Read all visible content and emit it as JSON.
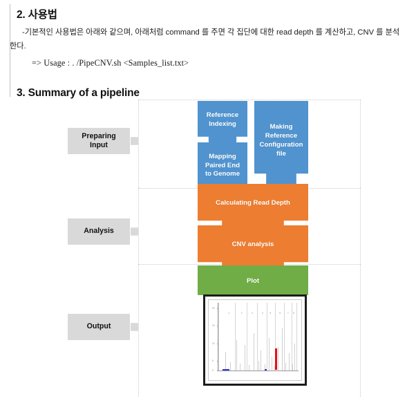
{
  "document": {
    "section2": {
      "heading": "2. 사용법",
      "paragraph": "-기본적인 사용법은 아래와 같으며, 아래처럼 command 를 주면 각 집단에 대한 read depth 를 계산하고, CNV 를 분석한다.",
      "usage": "=> Usage : . /PipeCNV.sh <Samples_list.txt>"
    },
    "section3": {
      "heading": "3. Summary of a pipeline"
    }
  },
  "pipeline": {
    "stages": [
      {
        "label_line1": "Preparing",
        "label_line2": "Input"
      },
      {
        "label_line1": "Analysis",
        "label_line2": ""
      },
      {
        "label_line1": "Output",
        "label_line2": ""
      }
    ],
    "blocks": {
      "reference_indexing": "Reference\nIndexing",
      "mapping": "Mapping\nPaired End\nto Genome",
      "making_reference": "Making\nReference\nConfiguration\nfile",
      "calculating_read_depth": "Calculating Read Depth",
      "cnv_analysis": "CNV analysis",
      "plot": "Plot"
    },
    "colors": {
      "blue": "#5093cf",
      "orange": "#ed7d31",
      "green": "#70ad47",
      "stage_gray": "#d9d9d9",
      "plot_blue": "#3333cc",
      "plot_red": "#e81010"
    }
  },
  "chart_data": {
    "type": "scatter",
    "title": "",
    "xlabel": "",
    "ylabel": "",
    "categories": [
      "1",
      "2",
      "3",
      "4",
      "5",
      "6",
      "7",
      "8"
    ],
    "chrom_label_x": [
      13,
      29,
      42,
      55,
      65,
      77,
      87,
      94
    ],
    "separator_x": [
      0,
      21,
      35,
      48,
      60,
      71,
      82,
      91,
      97
    ],
    "yticks": [
      "20",
      "15",
      "10",
      "5",
      "0"
    ],
    "ytick_y": [
      8,
      34,
      60,
      86,
      100
    ],
    "ylim": [
      0,
      20
    ],
    "grid": false,
    "legend": null,
    "series": [
      {
        "name": "read-depth-spikes",
        "x": [
          9,
          15,
          22,
          27,
          33,
          38,
          44,
          50,
          53,
          58,
          63,
          66,
          70,
          74,
          79,
          84,
          88,
          92,
          95
        ],
        "height_pct": [
          28,
          12,
          45,
          10,
          38,
          8,
          55,
          14,
          30,
          9,
          48,
          20,
          7,
          35,
          62,
          11,
          26,
          9,
          40
        ]
      },
      {
        "name": "blue-markers",
        "x": [
          5,
          58
        ],
        "width_pct": [
          9,
          2
        ],
        "color": "#3333cc"
      },
      {
        "name": "red-cnv-call",
        "x": [
          71
        ],
        "height_pct": [
          32
        ],
        "color": "#e81010"
      }
    ]
  }
}
